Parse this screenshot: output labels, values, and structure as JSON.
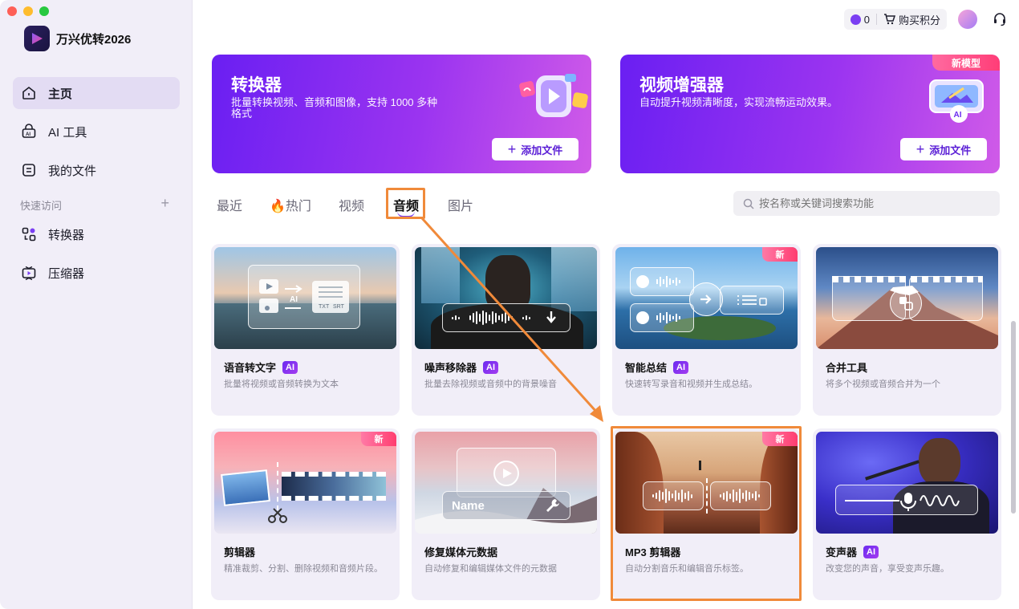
{
  "app": {
    "name": "万兴优转2026"
  },
  "sidebar": {
    "items": [
      {
        "label": "主页",
        "icon": "home-icon"
      },
      {
        "label": "AI 工具",
        "icon": "ai-tools-icon"
      },
      {
        "label": "我的文件",
        "icon": "file-icon"
      }
    ],
    "quick_access_label": "快速访问",
    "quick_items": [
      {
        "label": "转换器",
        "icon": "converter-icon"
      },
      {
        "label": "压缩器",
        "icon": "compressor-icon"
      }
    ]
  },
  "topbar": {
    "points": "0",
    "buy_label": "购买积分"
  },
  "banners": [
    {
      "title": "转换器",
      "desc": "批量转换视频、音频和图像，支持 1000 多种格式",
      "button": "添加文件"
    },
    {
      "title": "视频增强器",
      "desc": "自动提升视频清晰度，实现流畅运动效果。",
      "button": "添加文件",
      "badge": "新模型"
    }
  ],
  "tabs": [
    "最近",
    "热门",
    "视频",
    "音频",
    "图片"
  ],
  "active_tab": "音频",
  "search": {
    "placeholder": "按名称或关键词搜索功能"
  },
  "cards": [
    {
      "title": "语音转文字",
      "ai": true,
      "desc": "批量将视频或音频转换为文本"
    },
    {
      "title": "噪声移除器",
      "ai": true,
      "desc": "批量去除视频或音频中的背景噪音"
    },
    {
      "title": "智能总结",
      "ai": true,
      "desc": "快速转写录音和视频并生成总结。",
      "badge": "新"
    },
    {
      "title": "合并工具",
      "ai": false,
      "desc": "将多个视频或音频合并为一个"
    },
    {
      "title": "剪辑器",
      "ai": false,
      "desc": "精准裁剪、分割、删除视频和音频片段。",
      "badge": "新"
    },
    {
      "title": "修复媒体元数据",
      "ai": false,
      "desc": "自动修复和编辑媒体文件的元数据",
      "overlay": "Name"
    },
    {
      "title": "MP3 剪辑器",
      "ai": false,
      "desc": "自动分割音乐和编辑音乐标签。",
      "badge": "新"
    },
    {
      "title": "变声器",
      "ai": true,
      "desc": "改变您的声音，享受变声乐趣。"
    }
  ],
  "ai_badge": "AI",
  "thumb_labels": {
    "ai": "AI",
    "txt": "TXT",
    "srt": "SRT"
  },
  "colors": {
    "accent": "#7b3ff2",
    "highlight": "#f08a3a",
    "new_badge": "#ff3d70"
  }
}
